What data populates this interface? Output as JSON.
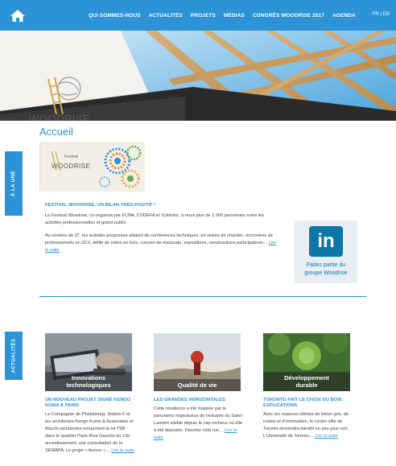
{
  "nav": {
    "home_icon": "home-icon",
    "links": [
      "QUI SOMMES-NOUS",
      "ACTUALITÉS",
      "PROJETS",
      "MÉDIAS",
      "CONGRÈS WOODRISE 2017",
      "AGENDA"
    ],
    "lang": "FR | EN"
  },
  "banner": {
    "logo_text": "WOODRISE"
  },
  "page": {
    "title": "Accueil"
  },
  "tabs": {
    "une": "À LA UNE",
    "actualites": "ACTUALITÉS"
  },
  "featured": {
    "image_line1": "Festival",
    "image_line2": "WOODRISE",
    "title": "FESTIVAL WOODRISE, UN BILAN TRÈS POSITIF !",
    "paragraph1": "Le Festival Woodrise, co-organisé par FCBA, CODEFA et Xylofutur, a réuni plus de 1 500 personnes entre les activités professionnelles et grand public.",
    "paragraph2": "Au nombre de 37, les activités proposées allaient de conférences techniques, en visites de chantier, rencontres de professionnels en 2CV, défilé de robes en bois, concert de maracatu, expositions, constructions participatives…",
    "read_more": "Lire la suite"
  },
  "linkedin": {
    "logo": "in",
    "text_line1": "Faites partie du",
    "text_line2": "groupe Woodrise"
  },
  "cards": [
    {
      "caption_line1": "Innovations",
      "caption_line2": "technologiques",
      "title": "UN NOUVEAU PROJET SIGNÉ KENGO KUMA À PARIS",
      "text": "La Compagnie de Phalsbourg, Station F et les architectes Kengo Kuma & Associates et Marchi architectes remportent le lot T5B dans le quartier Paris Rive Gauche du 13e arrondissement, une consultation de la SEMAPA. Le projet « Aurore »…",
      "read_more": "Lire la suite"
    },
    {
      "caption_line1": "Qualité de vie",
      "caption_line2": "",
      "title": "LES GRANDES HORIZONTALES",
      "text": "Cette résidence a été inspirée par le panorama majestueux de l'estuaire du Saint-Laurent visible depuis le cap rocheux où elle a été déposée. Discrète côté rue…",
      "read_more": "Lire la suite"
    },
    {
      "caption_line1": "Développement",
      "caption_line2": "durable",
      "title": "TORONTO FAIT LE CHOIX DU BOIS : EXPLICATIONS",
      "text": "Avec les nuances infinies de béton gris, de routes et d'immeubles, le centre-ville de Toronto deviendra bientôt un peu plus vert. L'Université de Toronto…",
      "read_more": "Lire la suite"
    }
  ],
  "colors": {
    "accent": "#2b93d6",
    "linkedin": "#0e76a8"
  }
}
